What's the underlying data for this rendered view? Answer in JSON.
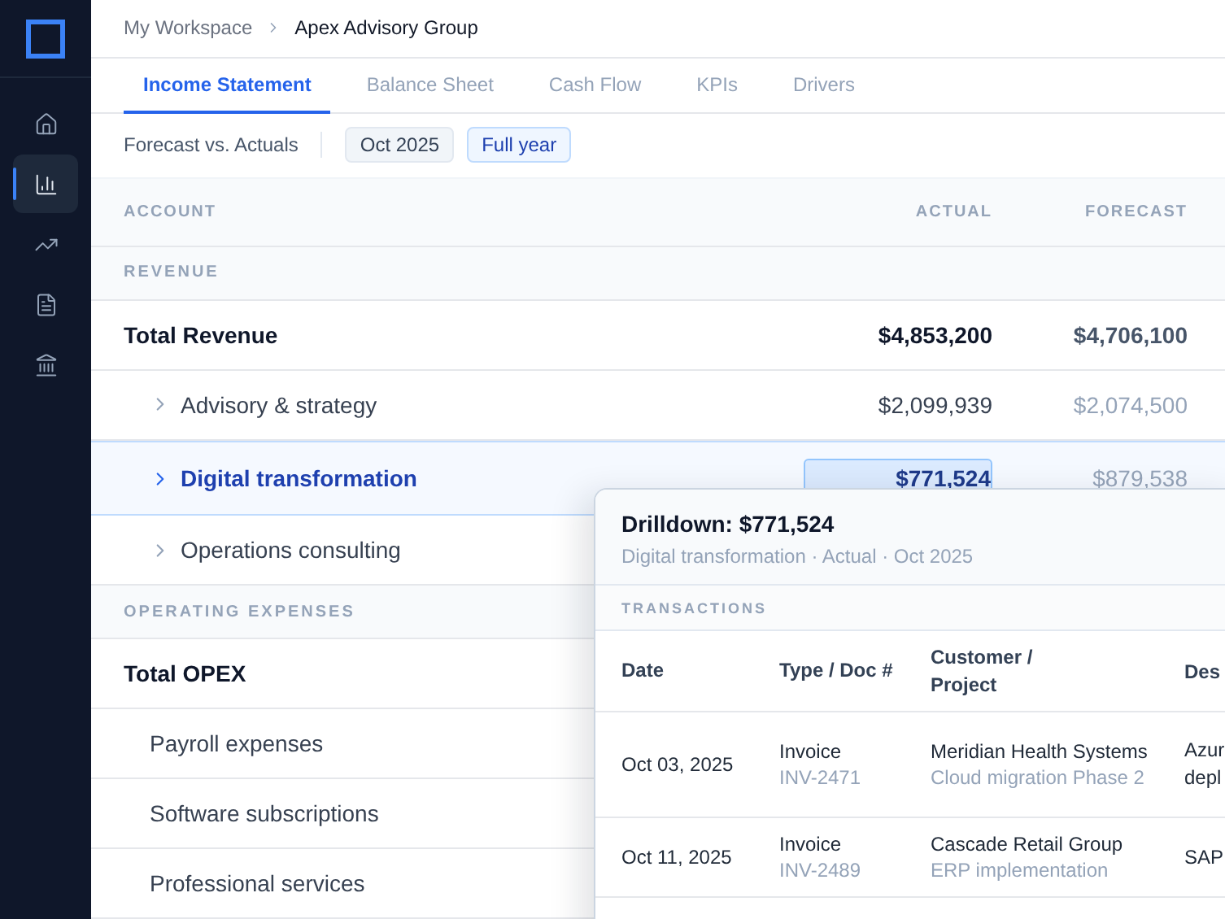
{
  "sidebar": {
    "items": [
      {
        "selected": false
      },
      {
        "selected": true
      },
      {
        "selected": false
      },
      {
        "selected": false
      },
      {
        "selected": false
      }
    ]
  },
  "breadcrumb": [
    "My Workspace",
    "Apex Advisory Group"
  ],
  "tabs": [
    {
      "label": "Income Statement",
      "selected": true
    },
    {
      "label": "Balance Sheet",
      "selected": false
    },
    {
      "label": "Cash Flow",
      "selected": false
    },
    {
      "label": "KPIs",
      "selected": false
    },
    {
      "label": "Drivers",
      "selected": false
    }
  ],
  "filters": {
    "label": "Forecast vs. Actuals",
    "chips": [
      {
        "label": "Oct 2025",
        "selected": false
      },
      {
        "label": "Full year",
        "selected": true
      }
    ]
  },
  "table": {
    "columns": [
      "ACCOUNT",
      "ACTUAL",
      "FORECAST"
    ],
    "rows": [
      {
        "kind": "section",
        "account": "REVENUE"
      },
      {
        "kind": "total",
        "account": "Total Revenue",
        "actual": "$4,853,200",
        "forecast": "$4,706,100"
      },
      {
        "kind": "line",
        "account": "Advisory & strategy",
        "actual": "$2,099,939",
        "forecast": "$2,074,500",
        "expandable": true,
        "selected": false
      },
      {
        "kind": "line",
        "account": "Digital transformation",
        "actual": "$771,524",
        "forecast": "$879,538",
        "expandable": true,
        "selected": true
      },
      {
        "kind": "line",
        "account": "Operations consulting",
        "expandable": true,
        "selected": false
      },
      {
        "kind": "section",
        "account": "OPERATING EXPENSES"
      },
      {
        "kind": "total",
        "account": "Total OPEX"
      },
      {
        "kind": "line",
        "account": "Payroll expenses",
        "expandable": false,
        "selected": false
      },
      {
        "kind": "line",
        "account": "Software subscriptions",
        "expandable": false,
        "selected": false
      },
      {
        "kind": "line",
        "account": "Professional services",
        "expandable": false,
        "selected": false
      }
    ]
  },
  "drilldown": {
    "title": "Drilldown: $771,524",
    "subtitle": "Digital transformation · Actual · Oct 2025",
    "section": "TRANSACTIONS",
    "columns": [
      "Date",
      "Type / Doc #",
      "Customer / Project",
      "Des"
    ],
    "rows": [
      {
        "date": "Oct 03, 2025",
        "type": "Invoice",
        "doc": "INV-2471",
        "customer": "Meridian Health Systems",
        "project": "Cloud migration Phase 2",
        "description": "Azur depl"
      },
      {
        "date": "Oct 11, 2025",
        "type": "Invoice",
        "doc": "INV-2489",
        "customer": "Cascade Retail Group",
        "project": "ERP implementation",
        "description": "SAP"
      }
    ]
  }
}
